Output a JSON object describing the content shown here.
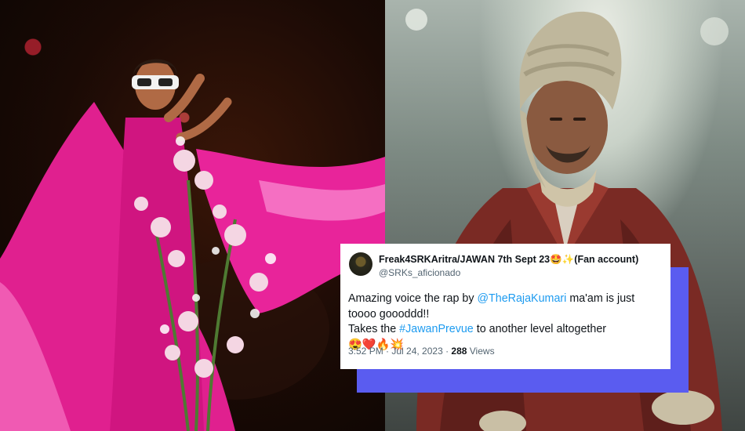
{
  "tweet": {
    "display_name": "Freak4SRKAritra/JAWAN 7th Sept 23",
    "name_emoji": "🤩✨",
    "name_suffix": "(Fan account)",
    "handle": "@SRKs_aficionado",
    "text_1": "Amazing voice the rap by ",
    "mention": "@TheRajaKumari",
    "text_2": " ma'am is just toooo goooddd!!",
    "text_3": "Takes the ",
    "hashtag": "#JawanPrevue",
    "text_4": " to another level altogether ",
    "text_emoji": "😍❤️🔥💥",
    "timestamp": "3:52 PM · Jul 24, 2023 · ",
    "views_count": "288",
    "views_label": " Views"
  },
  "colors": {
    "link": "#1d9bf0",
    "accent_shadow": "#5a5cf0",
    "dress_pink": "#e0208f"
  },
  "images": {
    "left": "performer-in-pink-gown-photo",
    "right": "man-with-bandaged-head-photo"
  }
}
